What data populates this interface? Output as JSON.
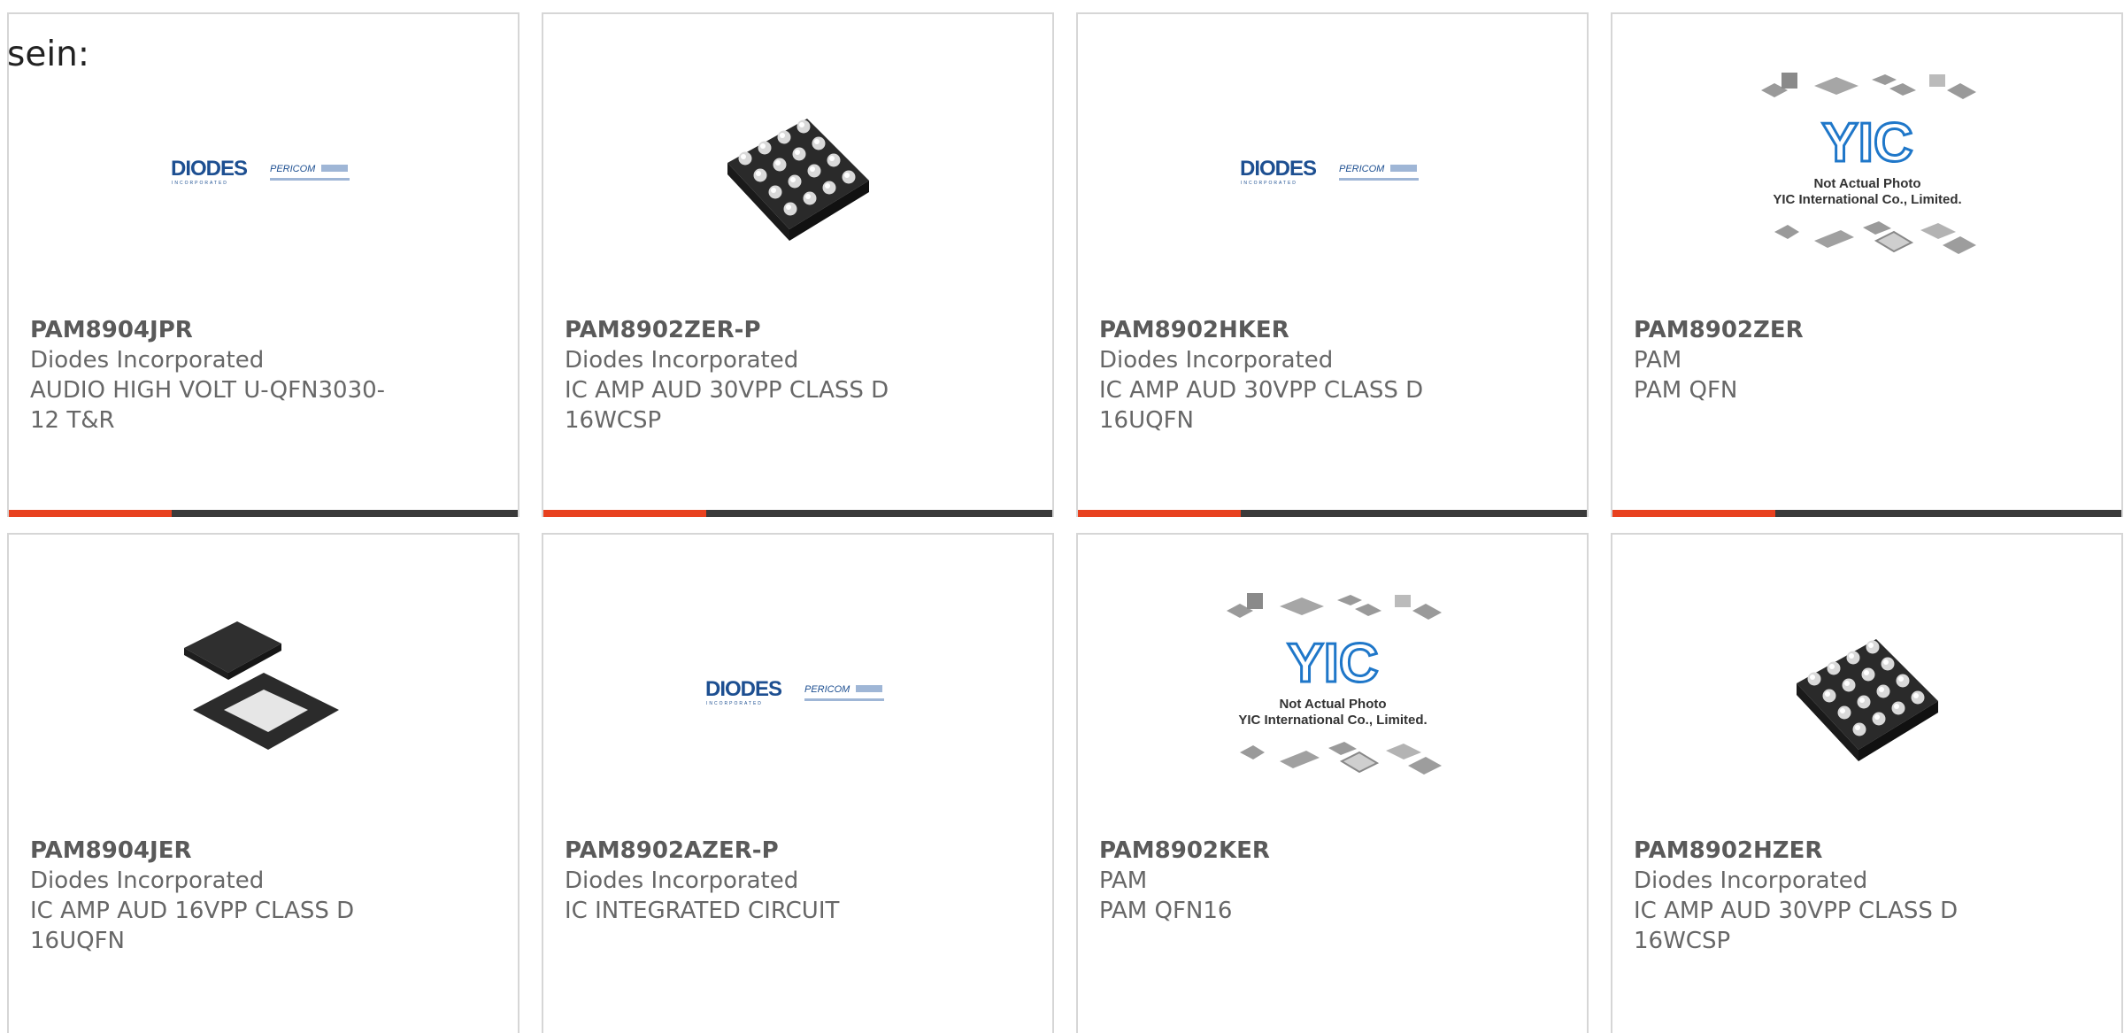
{
  "intro": "sein:",
  "colors": {
    "accent": "#e8411f",
    "bar": "#3a3a3a",
    "border": "#d6d6d6",
    "text": "#676767"
  },
  "products": [
    {
      "part": "PAM8904JPR",
      "maker": "Diodes Incorporated",
      "desc": "AUDIO HIGH VOLT U-QFN3030-12 T&R",
      "image": "diodes-logo"
    },
    {
      "part": "PAM8902ZER-P",
      "maker": "Diodes Incorporated",
      "desc": "IC AMP AUD 30VPP CLASS D 16WCSP",
      "image": "bga-chip"
    },
    {
      "part": "PAM8902HKER",
      "maker": "Diodes Incorporated",
      "desc": "IC AMP AUD 30VPP CLASS D 16UQFN",
      "image": "diodes-logo"
    },
    {
      "part": "PAM8902ZER",
      "maker": "PAM",
      "desc": "PAM QFN",
      "image": "yic-placeholder",
      "yic_line1": "Not Actual Photo",
      "yic_line2": "YIC International Co., Limited."
    },
    {
      "part": "PAM8904JER",
      "maker": "Diodes Incorporated",
      "desc": "IC AMP AUD 16VPP CLASS D 16UQFN",
      "image": "qfn-chip"
    },
    {
      "part": "PAM8902AZER-P",
      "maker": "Diodes Incorporated",
      "desc": "IC INTEGRATED CIRCUIT",
      "image": "diodes-logo"
    },
    {
      "part": "PAM8902KER",
      "maker": "PAM",
      "desc": "PAM QFN16",
      "image": "yic-placeholder",
      "yic_line1": "Not Actual Photo",
      "yic_line2": "YIC International Co., Limited."
    },
    {
      "part": "PAM8902HZER",
      "maker": "Diodes Incorporated",
      "desc": "IC AMP AUD 30VPP CLASS D 16WCSP",
      "image": "bga-chip"
    }
  ],
  "logo_text": {
    "diodes": "DIODES",
    "diodes_sub": "INCORPORATED",
    "pericom": "PERICOM",
    "yic": "YIC"
  }
}
